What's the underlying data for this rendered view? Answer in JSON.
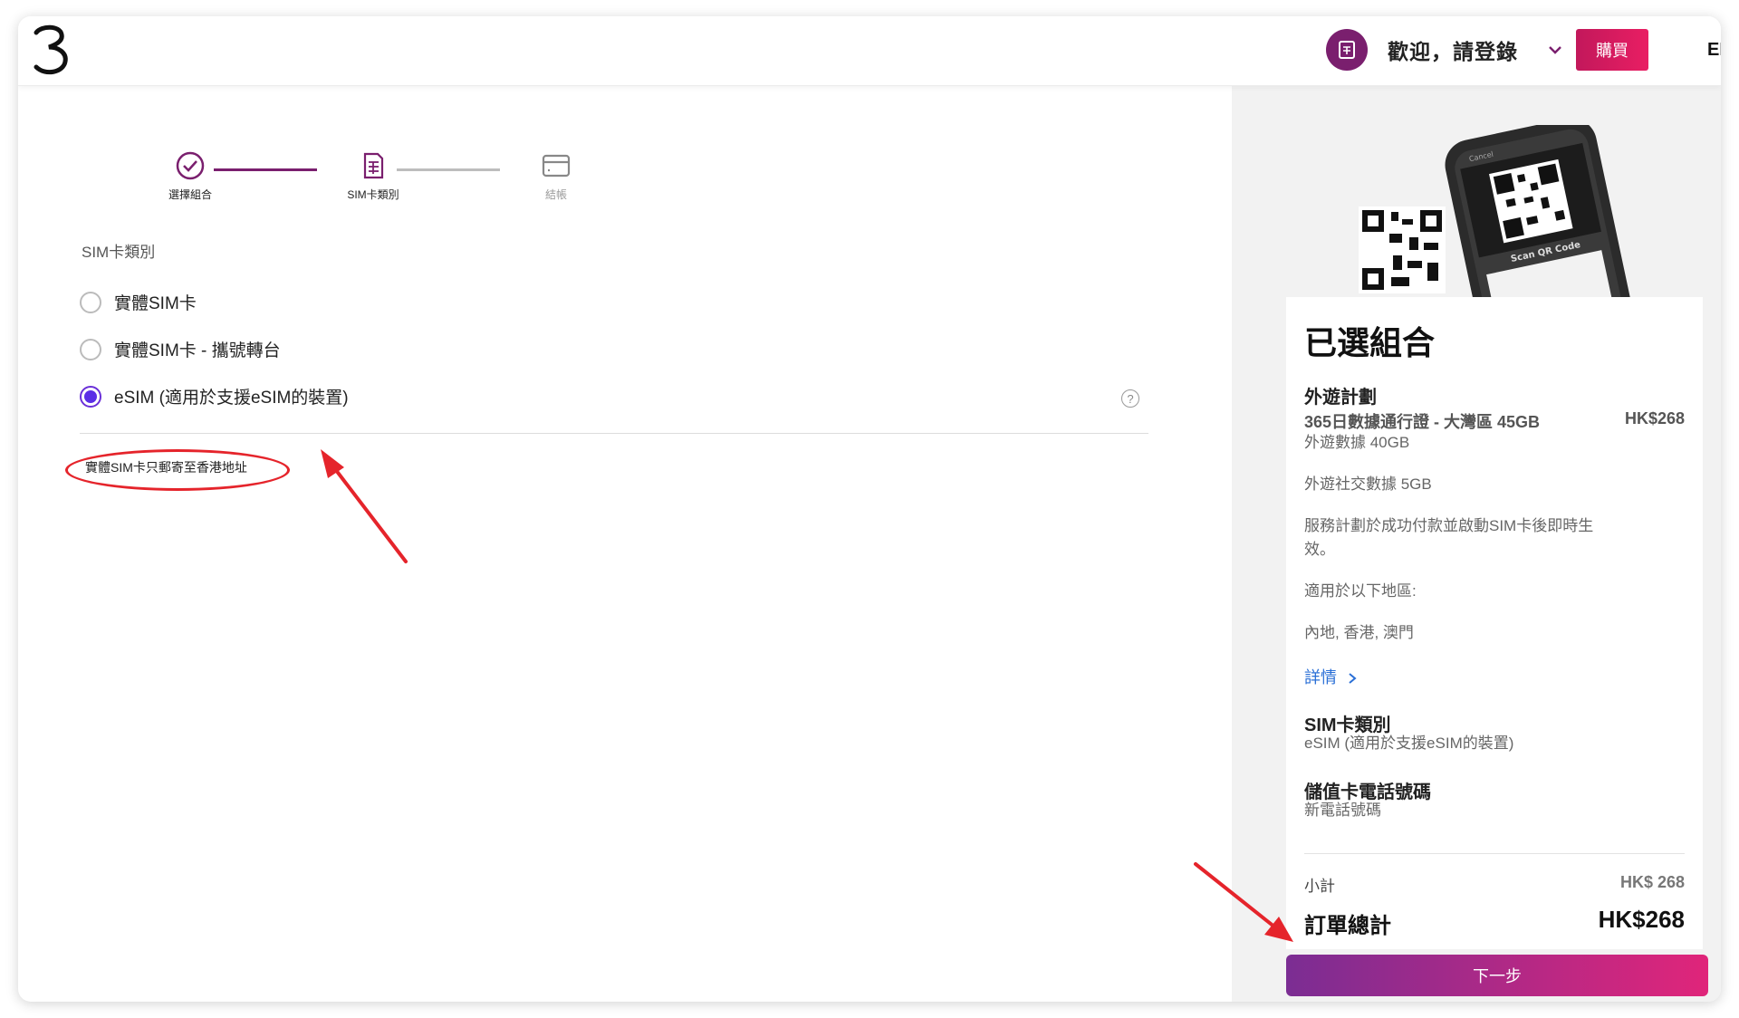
{
  "header": {
    "welcome": "歡迎，請登錄",
    "buy_label": "購買",
    "lang_label": "EI"
  },
  "stepper": {
    "steps": [
      {
        "label": "選擇組合",
        "state": "done"
      },
      {
        "label": "SIM卡類別",
        "state": "current"
      },
      {
        "label": "結帳",
        "state": "pending"
      }
    ]
  },
  "sim_section": {
    "title": "SIM卡類別",
    "options": [
      {
        "label": "實體SIM卡",
        "selected": false
      },
      {
        "label": "實體SIM卡 - 攜號轉台",
        "selected": false
      },
      {
        "label": "eSIM (適用於支援eSIM的裝置)",
        "selected": true
      }
    ],
    "help_glyph": "?",
    "note": "實體SIM卡只郵寄至香港地址"
  },
  "promo": {
    "phone_small_text": "Cancel",
    "scan_text": "Scan QR Code"
  },
  "summary": {
    "title": "已選組合",
    "plan_heading": "外遊計劃",
    "plan_name": "365日數據通行證 - 大灣區 45GB",
    "plan_price": "HK$268",
    "line1": "外遊數據 40GB",
    "line2": "外遊社交數據 5GB",
    "line3": "服務計劃於成功付款並啟動SIM卡後即時生效。",
    "line4": "適用於以下地區:",
    "line5": "內地, 香港, 澳門",
    "details_link": "詳情",
    "sim_heading": "SIM卡類別",
    "sim_value": "eSIM (適用於支援eSIM的裝置)",
    "number_heading": "儲值卡電話號碼",
    "number_value": "新電話號碼",
    "subtotal_label": "小計",
    "subtotal_value": "HK$ 268",
    "total_label": "訂單總計",
    "total_value": "HK$268"
  },
  "next_label": "下一步",
  "colors": {
    "brand": "#7a1f6e",
    "accent": "#e0257a",
    "radio": "#5b2ee6",
    "annotation": "#e5242b"
  }
}
